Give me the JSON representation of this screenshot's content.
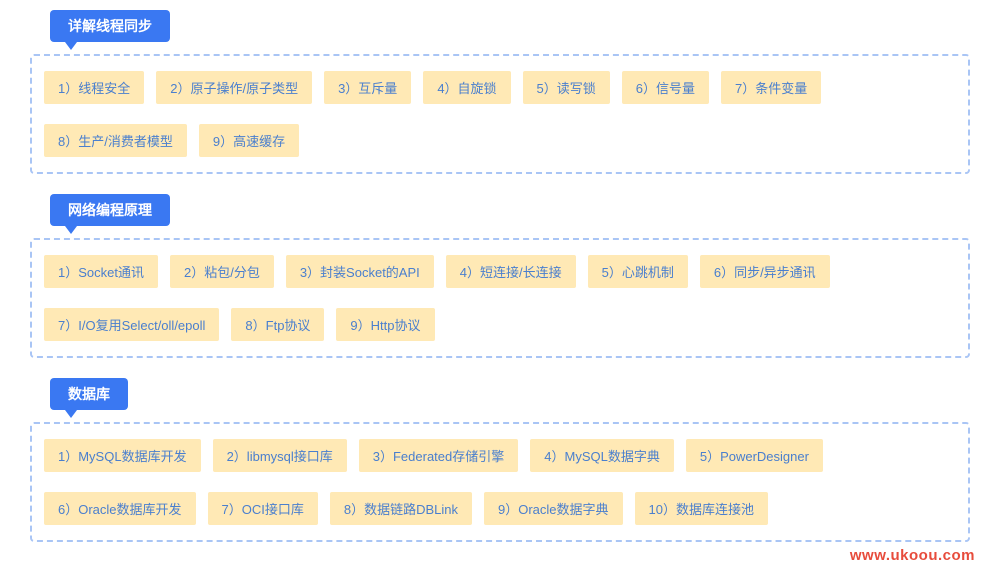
{
  "sections": [
    {
      "title": "详解线程同步",
      "items": [
        "1）线程安全",
        "2）原子操作/原子类型",
        "3）互斥量",
        "4）自旋锁",
        "5）读写锁",
        "6）信号量",
        "7）条件变量",
        "8）生产/消费者模型",
        "9）高速缓存"
      ]
    },
    {
      "title": "网络编程原理",
      "items": [
        "1）Socket通讯",
        "2）粘包/分包",
        "3）封装Socket的API",
        "4）短连接/长连接",
        "5）心跳机制",
        "6）同步/异步通讯",
        "7）I/O复用Select/oll/epoll",
        "8）Ftp协议",
        "9）Http协议"
      ]
    },
    {
      "title": "数据库",
      "items": [
        "1）MySQL数据库开发",
        "2）libmysql接口库",
        "3）Federated存储引擎",
        "4）MySQL数据字典",
        "5）PowerDesigner",
        "6）Oracle数据库开发",
        "7）OCI接口库",
        "8）数据链路DBLink",
        "9）Oracle数据字典",
        "10）数据库连接池"
      ]
    }
  ],
  "watermark": "www.ukoou.com"
}
